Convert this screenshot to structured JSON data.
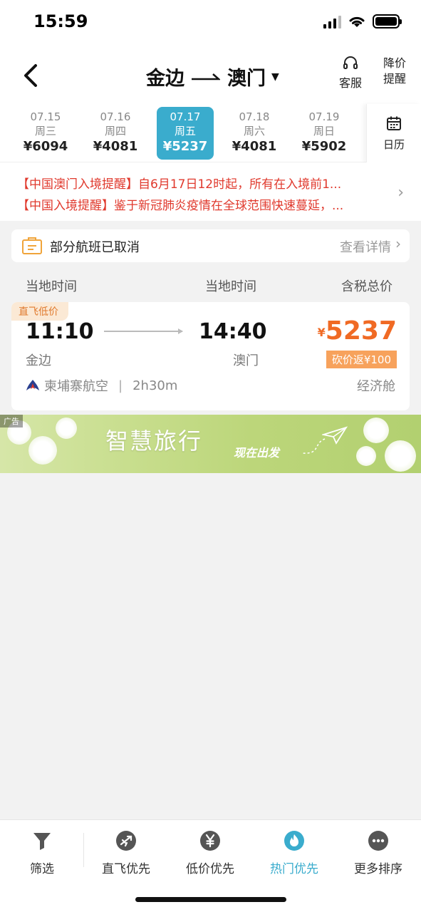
{
  "status_bar": {
    "time": "15:59"
  },
  "header": {
    "origin": "金边",
    "destination": "澳门",
    "service_label": "客服",
    "price_alert_line1": "降价",
    "price_alert_line2": "提醒"
  },
  "dates": [
    {
      "date": "07.15",
      "weekday": "周三",
      "price": "¥6094"
    },
    {
      "date": "07.16",
      "weekday": "周四",
      "price": "¥4081"
    },
    {
      "date": "07.17",
      "weekday": "周五",
      "price": "¥5237",
      "active": true
    },
    {
      "date": "07.18",
      "weekday": "周六",
      "price": "¥4081"
    },
    {
      "date": "07.19",
      "weekday": "周日",
      "price": "¥5902"
    }
  ],
  "calendar_label": "日历",
  "notices": [
    "【中国澳门入境提醒】自6月17日12时起，所有在入境前1...",
    "【中国入境提醒】鉴于新冠肺炎疫情在全球范围快速蔓延，..."
  ],
  "cancel_bar": {
    "text": "部分航班已取消",
    "detail": "查看详情"
  },
  "columns": {
    "dep": "当地时间",
    "arr": "当地时间",
    "price": "含税总价"
  },
  "flight": {
    "tag": "直飞低价",
    "dep_time": "11:10",
    "arr_time": "14:40",
    "dep_city": "金边",
    "arr_city": "澳门",
    "currency": "¥",
    "price": "5237",
    "rebate": "砍价返¥100",
    "airline": "柬埔寨航空",
    "separator": "|",
    "duration": "2h30m",
    "cabin": "经济舱"
  },
  "ad": {
    "tag": "广告",
    "title": "智慧旅行",
    "subtitle": "现在出发"
  },
  "tabs": [
    {
      "label": "筛选",
      "icon": "filter-icon"
    },
    {
      "label": "直飞优先",
      "icon": "plane-icon"
    },
    {
      "label": "低价优先",
      "icon": "yen-icon"
    },
    {
      "label": "热门优先",
      "icon": "flame-icon",
      "active": true
    },
    {
      "label": "更多排序",
      "icon": "more-icon"
    }
  ],
  "colors": {
    "accent": "#3aaccd",
    "price": "#f06a24",
    "notice": "#e0392d"
  }
}
